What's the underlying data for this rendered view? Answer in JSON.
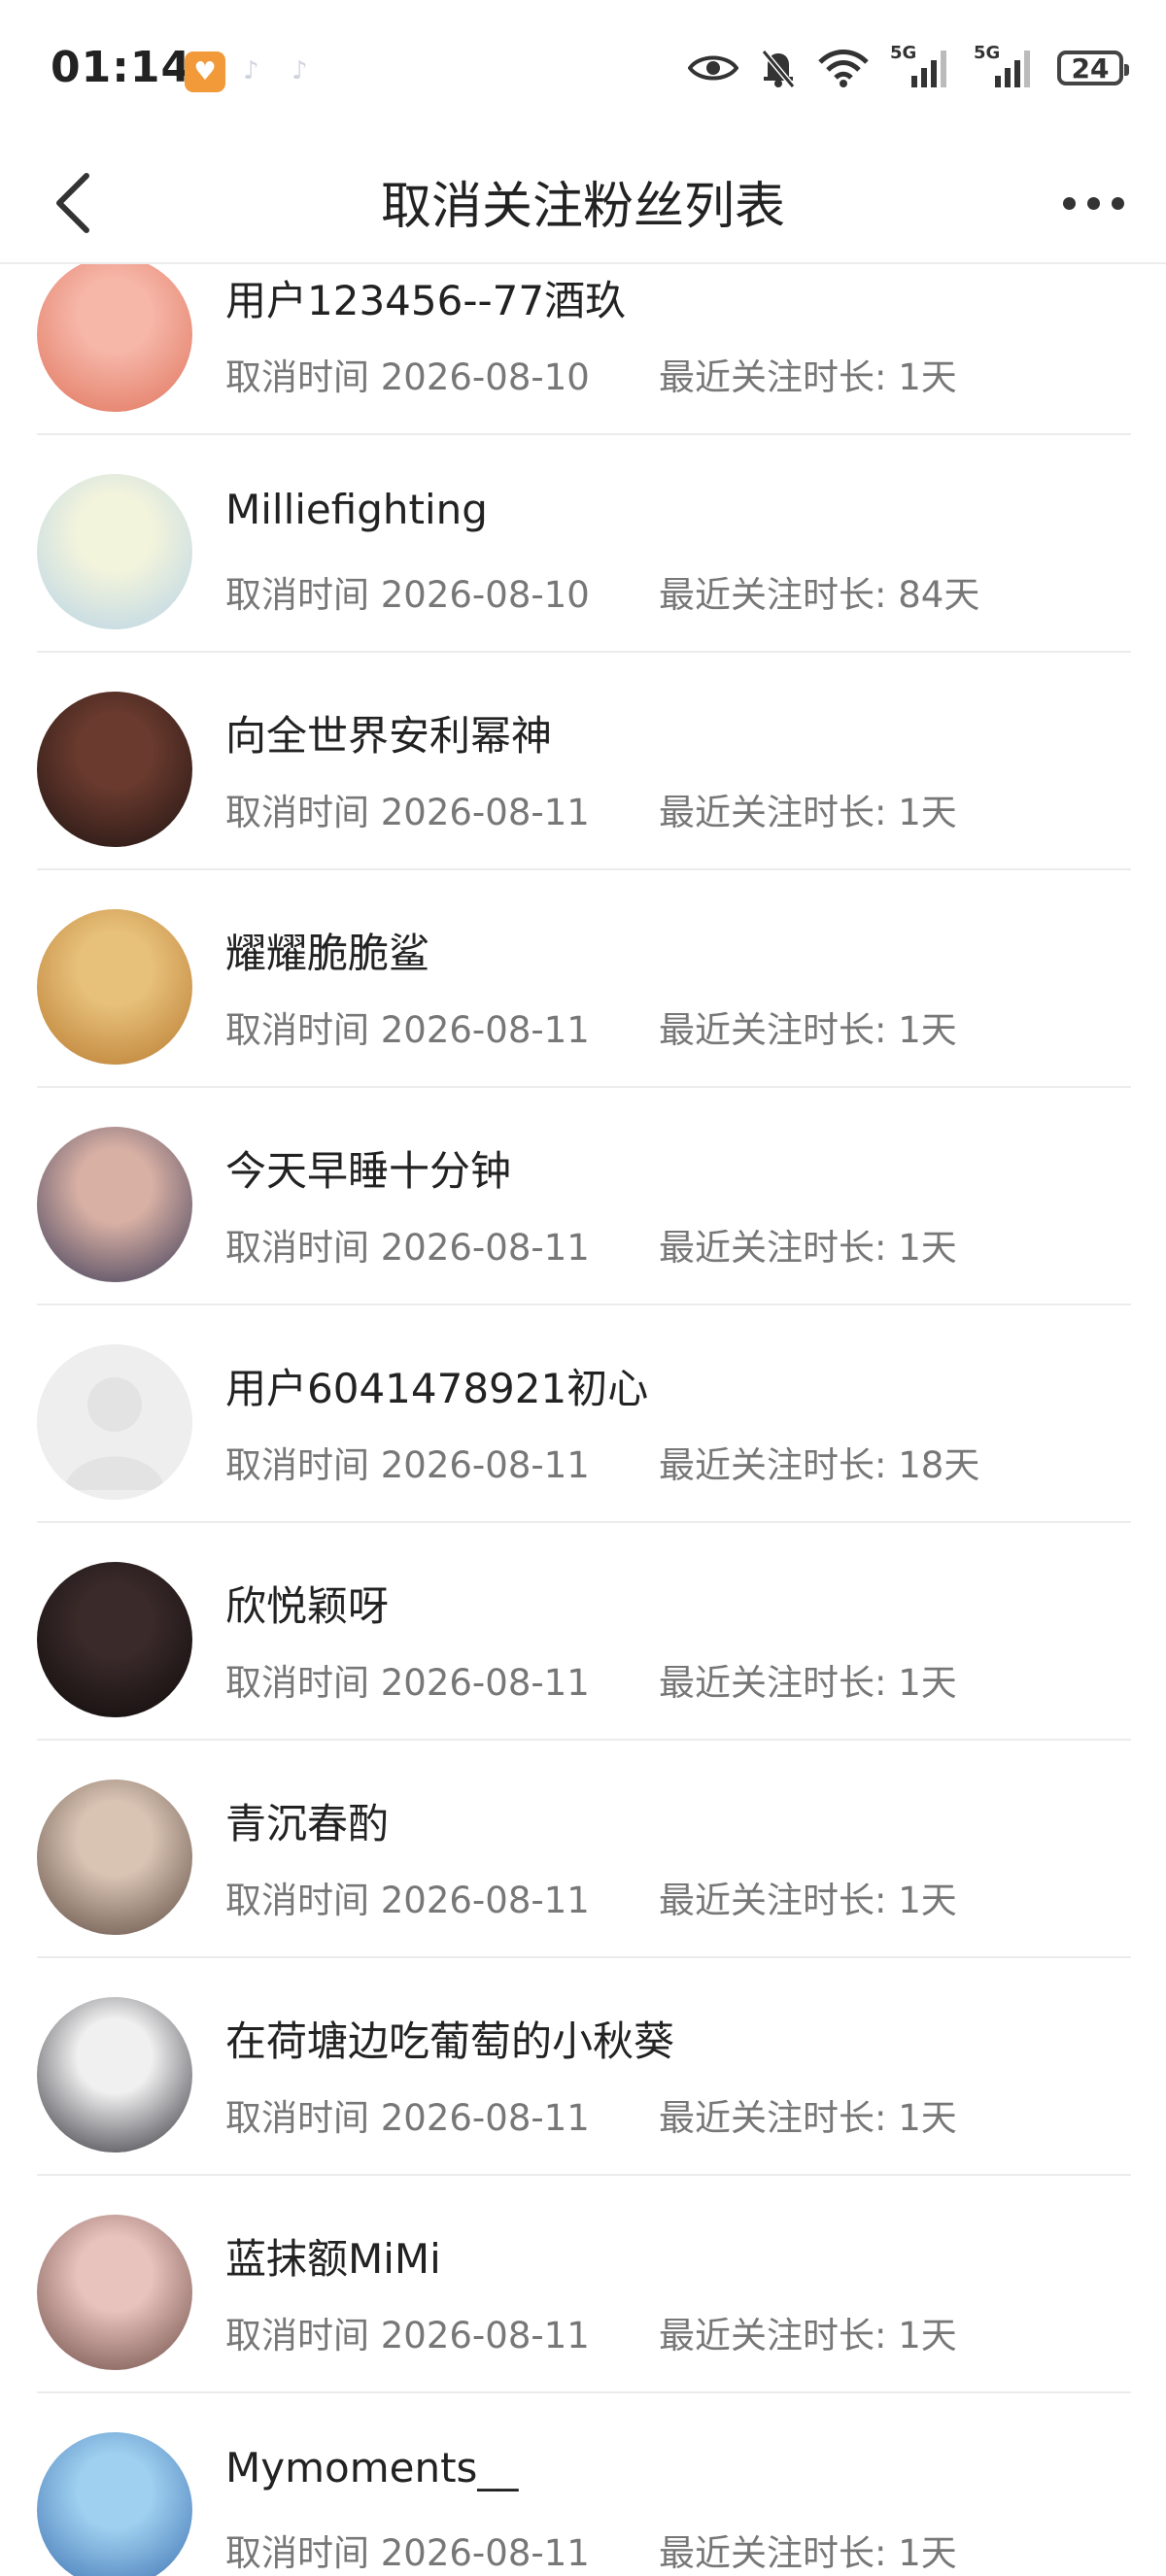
{
  "status_bar": {
    "time": "01:14",
    "battery": "24",
    "network_1": "5G",
    "network_2": "5G"
  },
  "header": {
    "title": "取消关注粉丝列表"
  },
  "labels": {
    "cancel_prefix": "取消时间",
    "duration_prefix": "最近关注时长:"
  },
  "items": [
    {
      "name": "用户123456--77酒玖",
      "date": "2026-08-10",
      "duration": "1天",
      "avatar_colors": [
        "#f6b6a8",
        "#e0745c"
      ]
    },
    {
      "name": "Milliefighting",
      "date": "2026-08-10",
      "duration": "84天",
      "avatar_colors": [
        "#f3f4dc",
        "#b7d3e6"
      ]
    },
    {
      "name": "向全世界安利幂神",
      "date": "2026-08-11",
      "duration": "1天",
      "avatar_colors": [
        "#6a3a2e",
        "#1f1412"
      ]
    },
    {
      "name": "耀耀脆脆鲨",
      "date": "2026-08-11",
      "duration": "1天",
      "avatar_colors": [
        "#e7c07a",
        "#b97a2f"
      ]
    },
    {
      "name": "今天早睡十分钟",
      "date": "2026-08-11",
      "duration": "1天",
      "avatar_colors": [
        "#d8b0a4",
        "#3c3b58"
      ]
    },
    {
      "name": "用户6041478921初心",
      "date": "2026-08-11",
      "duration": "18天",
      "avatar_colors": [
        "#eeeeee",
        "#e2e2e2"
      ]
    },
    {
      "name": "欣悦颖呀",
      "date": "2026-08-11",
      "duration": "1天",
      "avatar_colors": [
        "#3a2a2a",
        "#0e0a0a"
      ]
    },
    {
      "name": "青沉春酌",
      "date": "2026-08-11",
      "duration": "1天",
      "avatar_colors": [
        "#d9c4b4",
        "#5d4a40"
      ]
    },
    {
      "name": "在荷塘边吃葡萄的小秋葵",
      "date": "2026-08-11",
      "duration": "1天",
      "avatar_colors": [
        "#f0f0f0",
        "#2e2e36"
      ]
    },
    {
      "name": "蓝抹额MiMi",
      "date": "2026-08-11",
      "duration": "1天",
      "avatar_colors": [
        "#e8c2bc",
        "#6d4b46"
      ]
    },
    {
      "name": "Mymoments__",
      "date": "2026-08-11",
      "duration": "1天",
      "avatar_colors": [
        "#9fd0f0",
        "#3a6fb0"
      ]
    }
  ]
}
